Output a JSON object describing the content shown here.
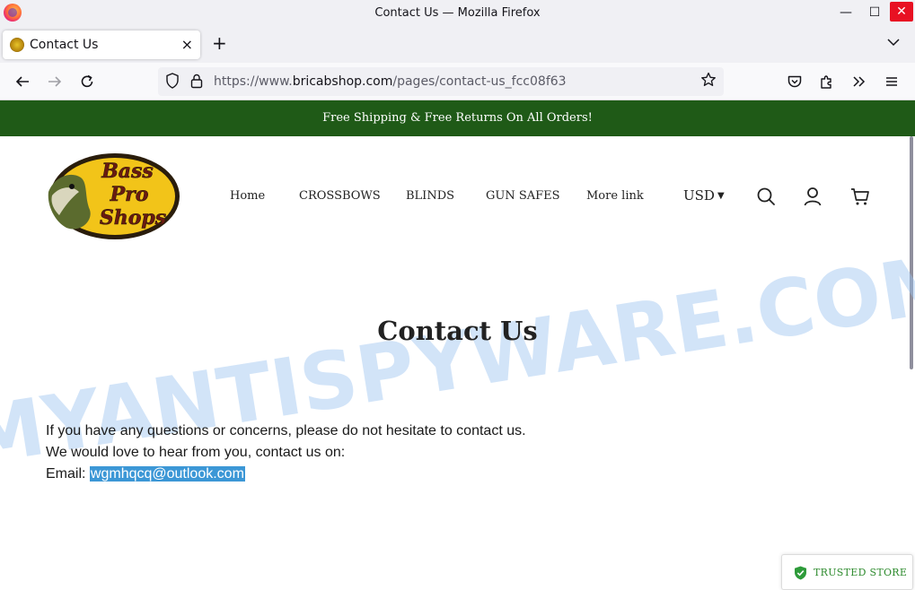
{
  "window": {
    "title": "Contact Us — Mozilla Firefox",
    "controls": {
      "minimize": "—",
      "maximize": "☐",
      "close": "✕"
    }
  },
  "tabs": [
    {
      "title": "Contact Us",
      "close": "×"
    }
  ],
  "tabstrip": {
    "new_tab": "+",
    "list_all": "⌄"
  },
  "urlbar": {
    "scheme": "https://www.",
    "host": "bricabshop.com",
    "path": "/pages/contact-us_fcc08f63"
  },
  "site": {
    "announcement": "Free Shipping & Free Returns On All Orders!",
    "announcement_bg": "#1f5a17",
    "logo": {
      "line1": "Bass",
      "line2": "Pro",
      "line3": "Shops"
    },
    "nav": [
      "Home",
      "CROSSBOWS",
      "BLINDS",
      "GUN SAFES",
      "More link"
    ],
    "currency": "USD"
  },
  "watermark": "MYANTISPYWARE.COM",
  "content": {
    "title": "Contact Us",
    "line1": "If you have any questions or concerns, please do not hesitate to contact us.",
    "line2": "We would love to hear from you, contact us on:",
    "email_label": "Email: ",
    "email": "wgmhqcq@outlook.com"
  },
  "badge": {
    "label": "TRUSTED STORE",
    "color": "#2e8b2e"
  }
}
